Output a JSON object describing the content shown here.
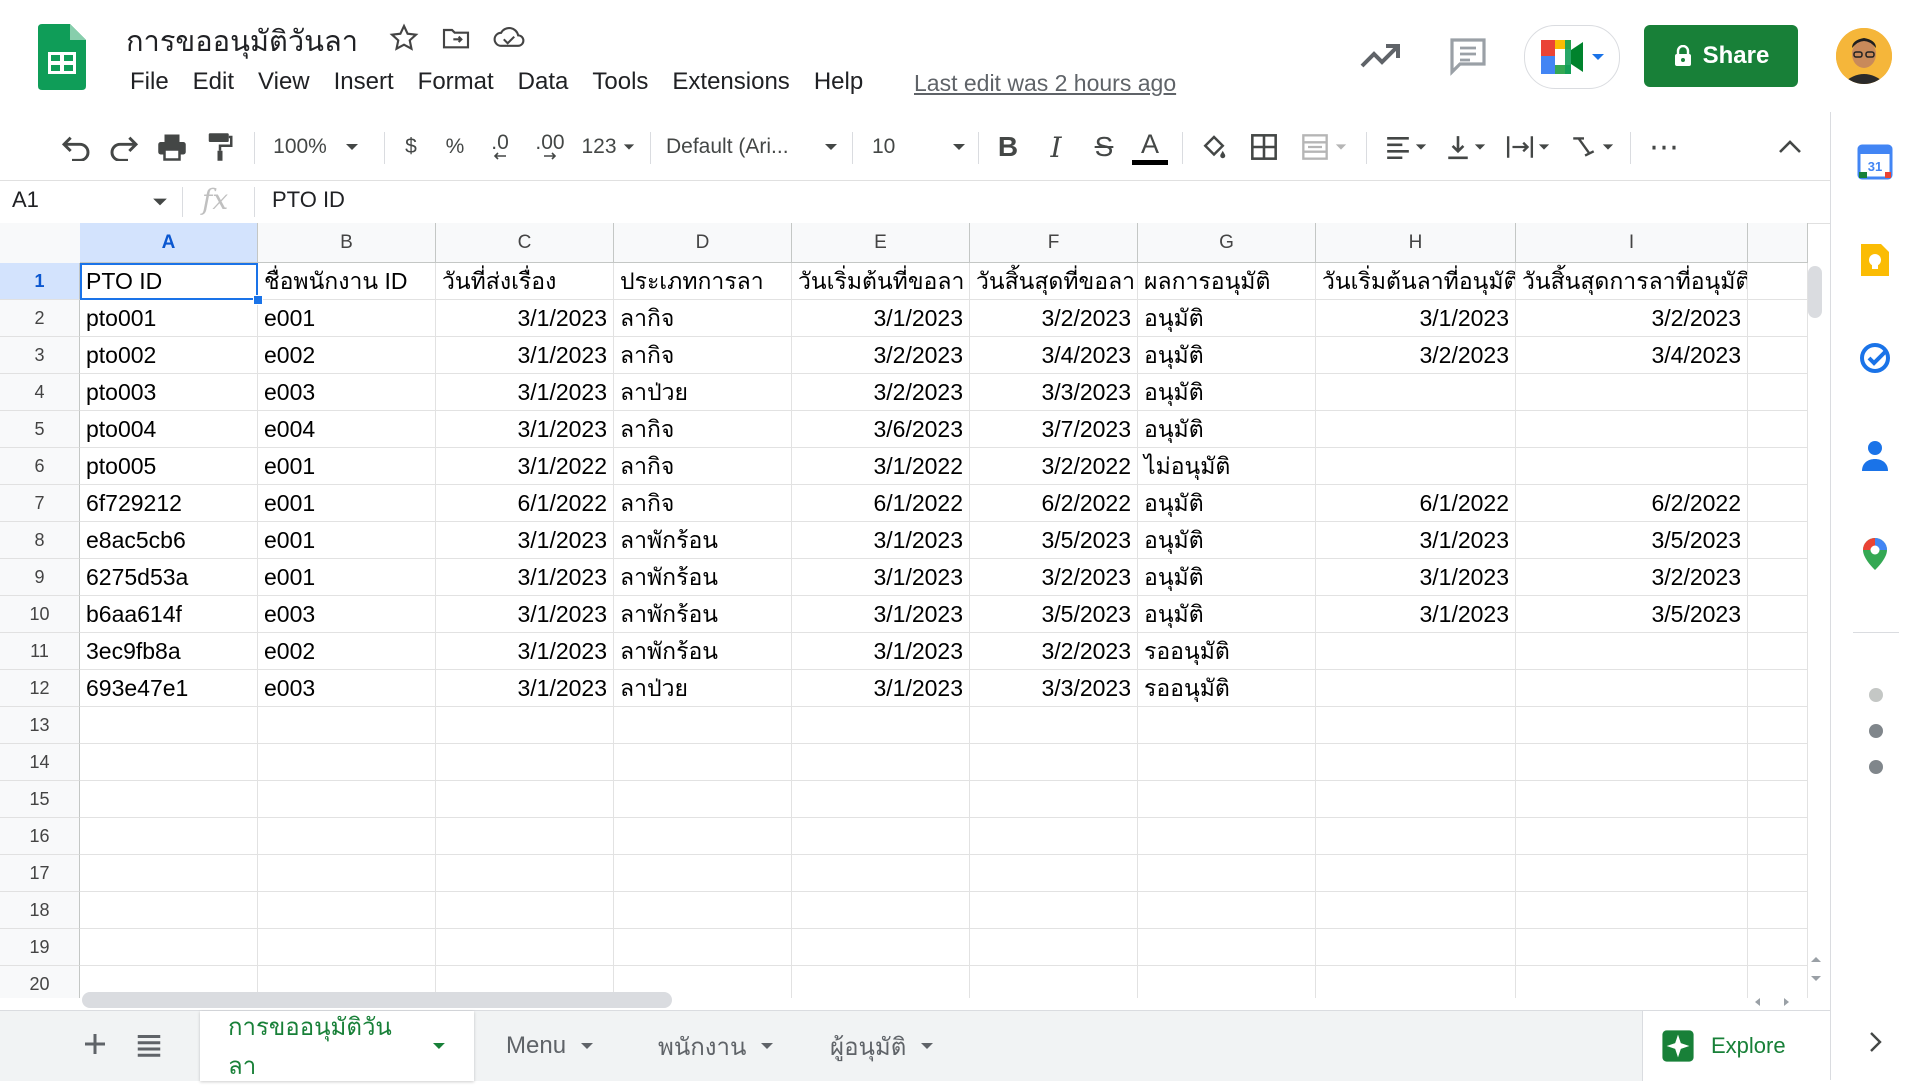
{
  "document": {
    "title": "การขออนุมัติวันลา",
    "last_edit": "Last edit was 2 hours ago"
  },
  "menu": [
    "File",
    "Edit",
    "View",
    "Insert",
    "Format",
    "Data",
    "Tools",
    "Extensions",
    "Help"
  ],
  "header": {
    "share_label": "Share",
    "icons": [
      "activity-trend-icon",
      "comments-icon",
      "google-meet-icon"
    ]
  },
  "toolbar": {
    "zoom": "100%",
    "currency": "$",
    "percent": "%",
    "decrease_decimal": ".0",
    "increase_decimal": ".00",
    "number_format": "123",
    "font": "Default (Ari...",
    "font_size": "10",
    "bold": "B",
    "italic": "I",
    "strikethrough": "S",
    "text_color": "A",
    "more": "⋯"
  },
  "formula_bar": {
    "name_box": "A1",
    "fx": "fx",
    "value": "PTO ID"
  },
  "grid": {
    "columns": [
      "A",
      "B",
      "C",
      "D",
      "E",
      "F",
      "G",
      "H",
      "I"
    ],
    "row_numbers": [
      "1",
      "2",
      "3",
      "4",
      "5",
      "6",
      "7",
      "8",
      "9",
      "10",
      "11",
      "12",
      "13",
      "14",
      "15",
      "16",
      "17",
      "18",
      "19",
      "20"
    ],
    "selected_cell": "A1",
    "rows": [
      [
        "PTO ID",
        "ชื่อพนักงาน ID",
        "วันที่ส่งเรื่อง",
        "ประเภทการลา",
        "วันเริ่มต้นที่ขอลา",
        "วันสิ้นสุดที่ขอลา",
        "ผลการอนุมัติ",
        "วันเริ่มต้นลาที่อนุมัติ",
        "วันสิ้นสุดการลาที่อนุมัติ"
      ],
      [
        "pto001",
        "e001",
        "3/1/2023",
        "ลากิจ",
        "3/1/2023",
        "3/2/2023",
        "อนุมัติ",
        "3/1/2023",
        "3/2/2023"
      ],
      [
        "pto002",
        "e002",
        "3/1/2023",
        "ลากิจ",
        "3/2/2023",
        "3/4/2023",
        "อนุมัติ",
        "3/2/2023",
        "3/4/2023"
      ],
      [
        "pto003",
        "e003",
        "3/1/2023",
        "ลาป่วย",
        "3/2/2023",
        "3/3/2023",
        "อนุมัติ",
        "",
        ""
      ],
      [
        "pto004",
        "e004",
        "3/1/2023",
        "ลากิจ",
        "3/6/2023",
        "3/7/2023",
        "อนุมัติ",
        "",
        ""
      ],
      [
        "pto005",
        "e001",
        "3/1/2022",
        "ลากิจ",
        "3/1/2022",
        "3/2/2022",
        "ไม่อนุมัติ",
        "",
        ""
      ],
      [
        "6f729212",
        "e001",
        "6/1/2022",
        "ลากิจ",
        "6/1/2022",
        "6/2/2022",
        "อนุมัติ",
        "6/1/2022",
        "6/2/2022"
      ],
      [
        "e8ac5cb6",
        "e001",
        "3/1/2023",
        "ลาพักร้อน",
        "3/1/2023",
        "3/5/2023",
        "อนุมัติ",
        "3/1/2023",
        "3/5/2023"
      ],
      [
        "6275d53a",
        "e001",
        "3/1/2023",
        "ลาพักร้อน",
        "3/1/2023",
        "3/2/2023",
        "อนุมัติ",
        "3/1/2023",
        "3/2/2023"
      ],
      [
        "b6aa614f",
        "e003",
        "3/1/2023",
        "ลาพักร้อน",
        "3/1/2023",
        "3/5/2023",
        "อนุมัติ",
        "3/1/2023",
        "3/5/2023"
      ],
      [
        "3ec9fb8a",
        "e002",
        "3/1/2023",
        "ลาพักร้อน",
        "3/1/2023",
        "3/2/2023",
        "รออนุมัติ",
        "",
        ""
      ],
      [
        "693e47e1",
        "e003",
        "3/1/2023",
        "ลาป่วย",
        "3/1/2023",
        "3/3/2023",
        "รออนุมัติ",
        "",
        ""
      ]
    ]
  },
  "sheets": {
    "tabs": [
      "การขออนุมัติวันลา",
      "Menu",
      "พนักงาน",
      "ผู้อนุมัติ"
    ],
    "active": 0,
    "explore_label": "Explore"
  },
  "side_panel": {
    "icons": [
      "calendar-icon",
      "keep-icon",
      "tasks-icon",
      "contacts-icon",
      "maps-icon"
    ],
    "calendar_day": "31"
  },
  "colors": {
    "accent": "#188038",
    "selection": "#1a73e8"
  }
}
